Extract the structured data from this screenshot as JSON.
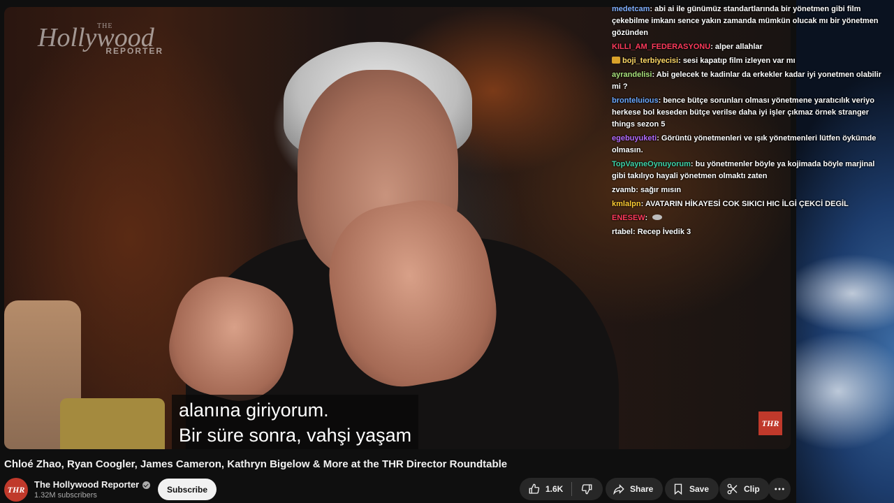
{
  "video": {
    "watermark_the": "THE",
    "watermark_name": "Hollywood",
    "watermark_reporter": "REPORTER",
    "corner_logo": "THR",
    "caption_line1": "alanına giriyorum.",
    "caption_line2": "Bir süre sonra, vahşi yaşam"
  },
  "chat": [
    {
      "user": "medetcam",
      "color": "#7fb0ff",
      "text": ": abi ai ile günümüz standartlarında bir yönetmen gibi film çekebilme imkanı sence yakın zamanda mümkün olucak mı bir yönetmen gözünden"
    },
    {
      "user": "KILLI_AM_FEDERASYONU",
      "color": "#ff3b5c",
      "text": ": alper allahlar"
    },
    {
      "user": "boji_terbiyecisi",
      "color": "#ffd966",
      "badge": true,
      "text": ": sesi kapatıp film izleyen var mı"
    },
    {
      "user": "ayrandelisi",
      "color": "#a8e07a",
      "text": ": Abi gelecek te kadinlar da erkekler kadar iyi yonetmen olabilir mi ?"
    },
    {
      "user": "bronteluious",
      "color": "#6aa8ff",
      "text": ": bence bütçe sorunları olması yönetmene yaratıcılık veriyo herkese bol keseden bütçe verilse daha iyi işler çıkmaz örnek stranger things sezon 5"
    },
    {
      "user": "egebuyuketi",
      "color": "#b46cff",
      "text": ": Görüntü yönetmenleri ve ışık yönetmenleri lütfen öykümde olmasın."
    },
    {
      "user": "TopVayneOynuyorum",
      "color": "#3fd4a8",
      "text": ": bu yönetmenler böyle ya kojimada böyle marjinal gibi takılıyo hayali yönetmen olmaktı zaten"
    },
    {
      "user": "zvamb",
      "color": "#ffffff",
      "text": ": sağır mısın"
    },
    {
      "user": "kmlalpn",
      "color": "#ffcc33",
      "text": ": AVATARIN HİKAYESİ COK SIKICI HIC İLGİ ÇEKCİ DEGİL"
    },
    {
      "user": "ENESEW",
      "color": "#ff3b5c",
      "emote": true,
      "text": ": "
    },
    {
      "user": "rtabel",
      "color": "#ffffff",
      "text": ": Recep İvedik 3"
    }
  ],
  "title": "Chloé Zhao, Ryan Coogler, James Cameron, Kathryn Bigelow & More at the THR Director Roundtable",
  "channel": {
    "avatar_text": "THR",
    "name": "The Hollywood Reporter",
    "subscribers": "1.32M subscribers",
    "subscribe_label": "Subscribe"
  },
  "actions": {
    "like_count": "1.6K",
    "share_label": "Share",
    "save_label": "Save",
    "clip_label": "Clip"
  }
}
